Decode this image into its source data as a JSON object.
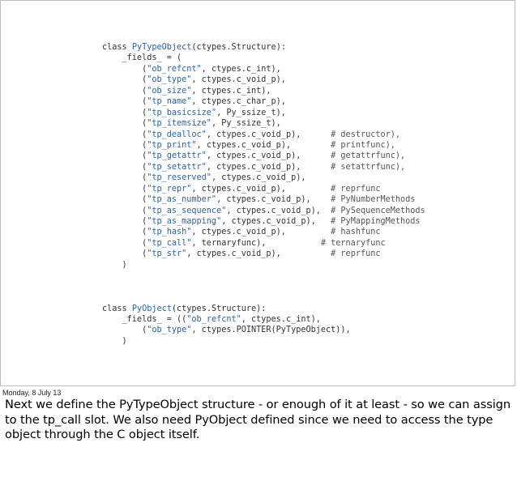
{
  "slide": {
    "code_lines": [
      [
        {
          "t": "kw",
          "v": "class "
        },
        {
          "t": "cls",
          "v": "PyTypeObject"
        },
        {
          "t": "plain",
          "v": "(ctypes.Structure):"
        }
      ],
      [
        {
          "t": "plain",
          "v": "    _fields_ = ("
        }
      ],
      [
        {
          "t": "plain",
          "v": "        ("
        },
        {
          "t": "str",
          "v": "\"ob_refcnt\""
        },
        {
          "t": "plain",
          "v": ", ctypes.c_int),"
        }
      ],
      [
        {
          "t": "plain",
          "v": "        ("
        },
        {
          "t": "str",
          "v": "\"ob_type\""
        },
        {
          "t": "plain",
          "v": ", ctypes.c_void_p),"
        }
      ],
      [
        {
          "t": "plain",
          "v": "        ("
        },
        {
          "t": "str",
          "v": "\"ob_size\""
        },
        {
          "t": "plain",
          "v": ", ctypes.c_int),"
        }
      ],
      [
        {
          "t": "plain",
          "v": "        ("
        },
        {
          "t": "str",
          "v": "\"tp_name\""
        },
        {
          "t": "plain",
          "v": ", ctypes.c_char_p),"
        }
      ],
      [
        {
          "t": "plain",
          "v": "        ("
        },
        {
          "t": "str",
          "v": "\"tp_basicsize\""
        },
        {
          "t": "plain",
          "v": ", Py_ssize_t),"
        }
      ],
      [
        {
          "t": "plain",
          "v": "        ("
        },
        {
          "t": "str",
          "v": "\"tp_itemsize\""
        },
        {
          "t": "plain",
          "v": ", Py_ssize_t),"
        }
      ],
      [
        {
          "t": "plain",
          "v": "        ("
        },
        {
          "t": "str",
          "v": "\"tp_dealloc\""
        },
        {
          "t": "plain",
          "v": ", ctypes.c_void_p),      "
        },
        {
          "t": "cmt",
          "v": "# destructor),"
        }
      ],
      [
        {
          "t": "plain",
          "v": "        ("
        },
        {
          "t": "str",
          "v": "\"tp_print\""
        },
        {
          "t": "plain",
          "v": ", ctypes.c_void_p),        "
        },
        {
          "t": "cmt",
          "v": "# printfunc),"
        }
      ],
      [
        {
          "t": "plain",
          "v": "        ("
        },
        {
          "t": "str",
          "v": "\"tp_getattr\""
        },
        {
          "t": "plain",
          "v": ", ctypes.c_void_p),      "
        },
        {
          "t": "cmt",
          "v": "# getattrfunc),"
        }
      ],
      [
        {
          "t": "plain",
          "v": "        ("
        },
        {
          "t": "str",
          "v": "\"tp_setattr\""
        },
        {
          "t": "plain",
          "v": ", ctypes.c_void_p),      "
        },
        {
          "t": "cmt",
          "v": "# setattrfunc),"
        }
      ],
      [
        {
          "t": "plain",
          "v": "        ("
        },
        {
          "t": "str",
          "v": "\"tp_reserved\""
        },
        {
          "t": "plain",
          "v": ", ctypes.c_void_p),"
        }
      ],
      [
        {
          "t": "plain",
          "v": "        ("
        },
        {
          "t": "str",
          "v": "\"tp_repr\""
        },
        {
          "t": "plain",
          "v": ", ctypes.c_void_p),         "
        },
        {
          "t": "cmt",
          "v": "# reprfunc"
        }
      ],
      [
        {
          "t": "plain",
          "v": "        ("
        },
        {
          "t": "str",
          "v": "\"tp_as_number\""
        },
        {
          "t": "plain",
          "v": ", ctypes.c_void_p),    "
        },
        {
          "t": "cmt",
          "v": "# PyNumberMethods"
        }
      ],
      [
        {
          "t": "plain",
          "v": "        ("
        },
        {
          "t": "str",
          "v": "\"tp_as_sequence\""
        },
        {
          "t": "plain",
          "v": ", ctypes.c_void_p),  "
        },
        {
          "t": "cmt",
          "v": "# PySequenceMethods"
        }
      ],
      [
        {
          "t": "plain",
          "v": "        ("
        },
        {
          "t": "str",
          "v": "\"tp_as_mapping\""
        },
        {
          "t": "plain",
          "v": ", ctypes.c_void_p),   "
        },
        {
          "t": "cmt",
          "v": "# PyMappingMethods"
        }
      ],
      [
        {
          "t": "plain",
          "v": "        ("
        },
        {
          "t": "str",
          "v": "\"tp_hash\""
        },
        {
          "t": "plain",
          "v": ", ctypes.c_void_p),         "
        },
        {
          "t": "cmt",
          "v": "# hashfunc"
        }
      ],
      [
        {
          "t": "plain",
          "v": "        ("
        },
        {
          "t": "str",
          "v": "\"tp_call\""
        },
        {
          "t": "plain",
          "v": ", ternaryfunc),           "
        },
        {
          "t": "cmt",
          "v": "# ternaryfunc"
        }
      ],
      [
        {
          "t": "plain",
          "v": "        ("
        },
        {
          "t": "str",
          "v": "\"tp_str\""
        },
        {
          "t": "plain",
          "v": ", ctypes.c_void_p),          "
        },
        {
          "t": "cmt",
          "v": "# reprfunc"
        }
      ],
      [
        {
          "t": "plain",
          "v": "    )"
        }
      ],
      [
        {
          "t": "plain",
          "v": ""
        }
      ],
      [
        {
          "t": "plain",
          "v": ""
        }
      ],
      [
        {
          "t": "plain",
          "v": ""
        }
      ],
      [
        {
          "t": "kw",
          "v": "class "
        },
        {
          "t": "cls",
          "v": "PyObject"
        },
        {
          "t": "plain",
          "v": "(ctypes.Structure):"
        }
      ],
      [
        {
          "t": "plain",
          "v": "    _fields_ = (("
        },
        {
          "t": "str",
          "v": "\"ob_refcnt\""
        },
        {
          "t": "plain",
          "v": ", ctypes.c_int),"
        }
      ],
      [
        {
          "t": "plain",
          "v": "        ("
        },
        {
          "t": "str",
          "v": "\"ob_type\""
        },
        {
          "t": "plain",
          "v": ", ctypes.POINTER(PyTypeObject)),"
        }
      ],
      [
        {
          "t": "plain",
          "v": "    )"
        }
      ]
    ]
  },
  "footer": {
    "date": "Monday, 8 July 13",
    "notes": "Next we define the PyTypeObject structure - or enough of it at least - so we can assign to the tp_call slot. We also need PyObject defined since we need to access the type object through the C object itself."
  }
}
